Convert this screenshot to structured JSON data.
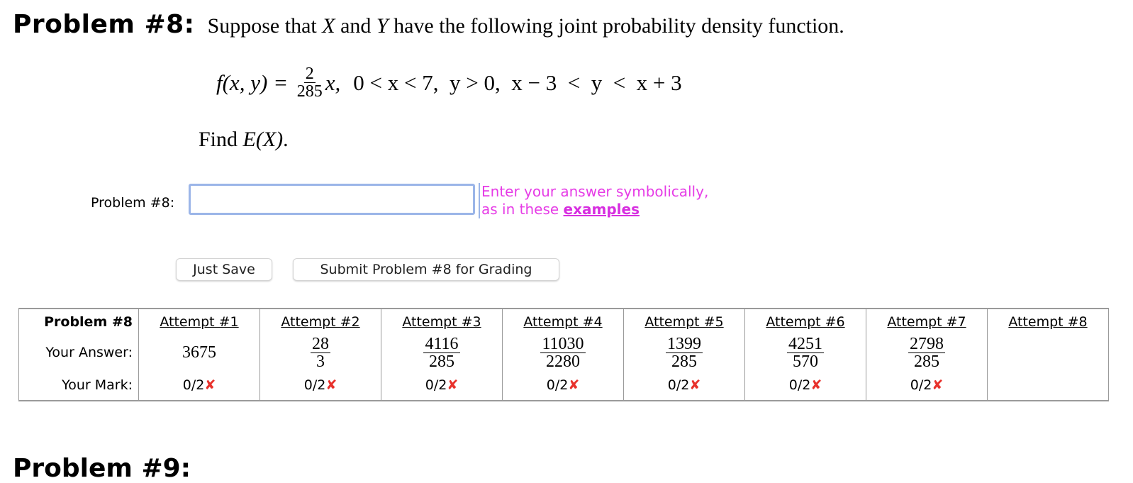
{
  "problem": {
    "label": "Problem #8:",
    "intro_before_x": "Suppose that",
    "var_x": "X",
    "and_word": "and",
    "var_y": "Y",
    "intro_after": "have the following joint probability density function.",
    "formula": {
      "lhs": "f(x, y)",
      "equals": "=",
      "coef_num": "2",
      "coef_den": "285",
      "rhs_var": "x,",
      "conditions": "0 < x < 7,  y > 0,  x − 3  <  y  <  x + 3"
    },
    "find_text": "Find",
    "find_expr": "E(X)",
    "find_end": "."
  },
  "answer": {
    "label": "Problem #8:",
    "value": "",
    "hint_line1": "Enter your answer symbolically,",
    "hint_line2": "as in these",
    "hint_link": "examples"
  },
  "buttons": {
    "save": "Just Save",
    "submit": "Submit Problem #8 for Grading"
  },
  "table": {
    "header_label": "Problem #8",
    "answer_label": "Your Answer:",
    "mark_label": "Your Mark:",
    "attempts": [
      {
        "title": "Attempt #1",
        "answer": "3675",
        "num": "",
        "den": "",
        "mark": "0/2",
        "x": "✘"
      },
      {
        "title": "Attempt #2",
        "answer": "",
        "num": "28",
        "den": "3",
        "mark": "0/2",
        "x": "✘"
      },
      {
        "title": "Attempt #3",
        "answer": "",
        "num": "4116",
        "den": "285",
        "mark": "0/2",
        "x": "✘"
      },
      {
        "title": "Attempt #4",
        "answer": "",
        "num": "11030",
        "den": "2280",
        "mark": "0/2",
        "x": "✘"
      },
      {
        "title": "Attempt #5",
        "answer": "",
        "num": "1399",
        "den": "285",
        "mark": "0/2",
        "x": "✘"
      },
      {
        "title": "Attempt #6",
        "answer": "",
        "num": "4251",
        "den": "570",
        "mark": "0/2",
        "x": "✘"
      },
      {
        "title": "Attempt #7",
        "answer": "",
        "num": "2798",
        "den": "285",
        "mark": "0/2",
        "x": "✘"
      },
      {
        "title": "Attempt #8",
        "answer": "",
        "num": "",
        "den": "",
        "mark": "",
        "x": ""
      }
    ]
  },
  "next_heading": "Problem #9:"
}
